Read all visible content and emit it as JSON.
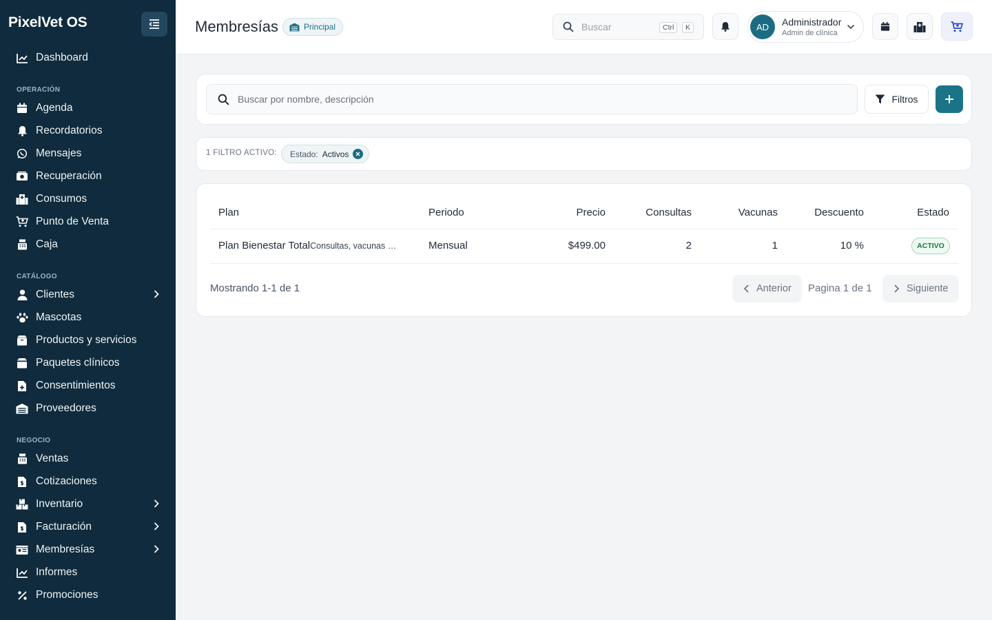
{
  "app": {
    "name": "PixelVet OS"
  },
  "sidebar": {
    "dashboard": "Dashboard",
    "sections": [
      "OPERACIÓN",
      "CATÁLOGO",
      "NEGOCIO"
    ],
    "operacion": [
      "Agenda",
      "Recordatorios",
      "Mensajes",
      "Recuperación",
      "Consumos",
      "Punto de Venta",
      "Caja"
    ],
    "catalogo": [
      "Clientes",
      "Mascotas",
      "Productos y servicios",
      "Paquetes clínicos",
      "Consentimientos",
      "Proveedores"
    ],
    "negocio": [
      "Ventas",
      "Cotizaciones",
      "Inventario",
      "Facturación",
      "Membresías",
      "Informes",
      "Promociones"
    ]
  },
  "header": {
    "title": "Membresías",
    "branch": "Principal",
    "search_placeholder": "Buscar",
    "shortcut_ctrl": "Ctrl",
    "shortcut_k": "K",
    "user": {
      "initials": "AD",
      "name": "Administrador",
      "role": "Admin de clínica"
    }
  },
  "toolbar": {
    "search_placeholder": "Buscar por nombre, descripción",
    "filters_label": "Filtros",
    "add_icon": "plus-icon"
  },
  "filters": {
    "active_label": "1 FILTRO ACTIVO:",
    "chip_key": "Estado:",
    "chip_value": "Activos"
  },
  "table": {
    "columns": [
      "Plan",
      "Periodo",
      "Precio",
      "Consultas",
      "Vacunas",
      "Descuento",
      "Estado"
    ],
    "rows": [
      {
        "plan": "Plan Bienestar Total",
        "description": "Consultas, vacunas …",
        "periodo": "Mensual",
        "precio": "$499.00",
        "consultas": "2",
        "vacunas": "1",
        "descuento": "10 %",
        "estado": "ACTIVO"
      }
    ]
  },
  "pagination": {
    "showing": "Mostrando 1-1 de 1",
    "prev": "Anterior",
    "page_info": "Pagina 1 de 1",
    "next": "Siguiente"
  },
  "colors": {
    "sidebar_bg": "#0f2b3d",
    "accent": "#1b7387",
    "status_green": "#147a3c"
  }
}
